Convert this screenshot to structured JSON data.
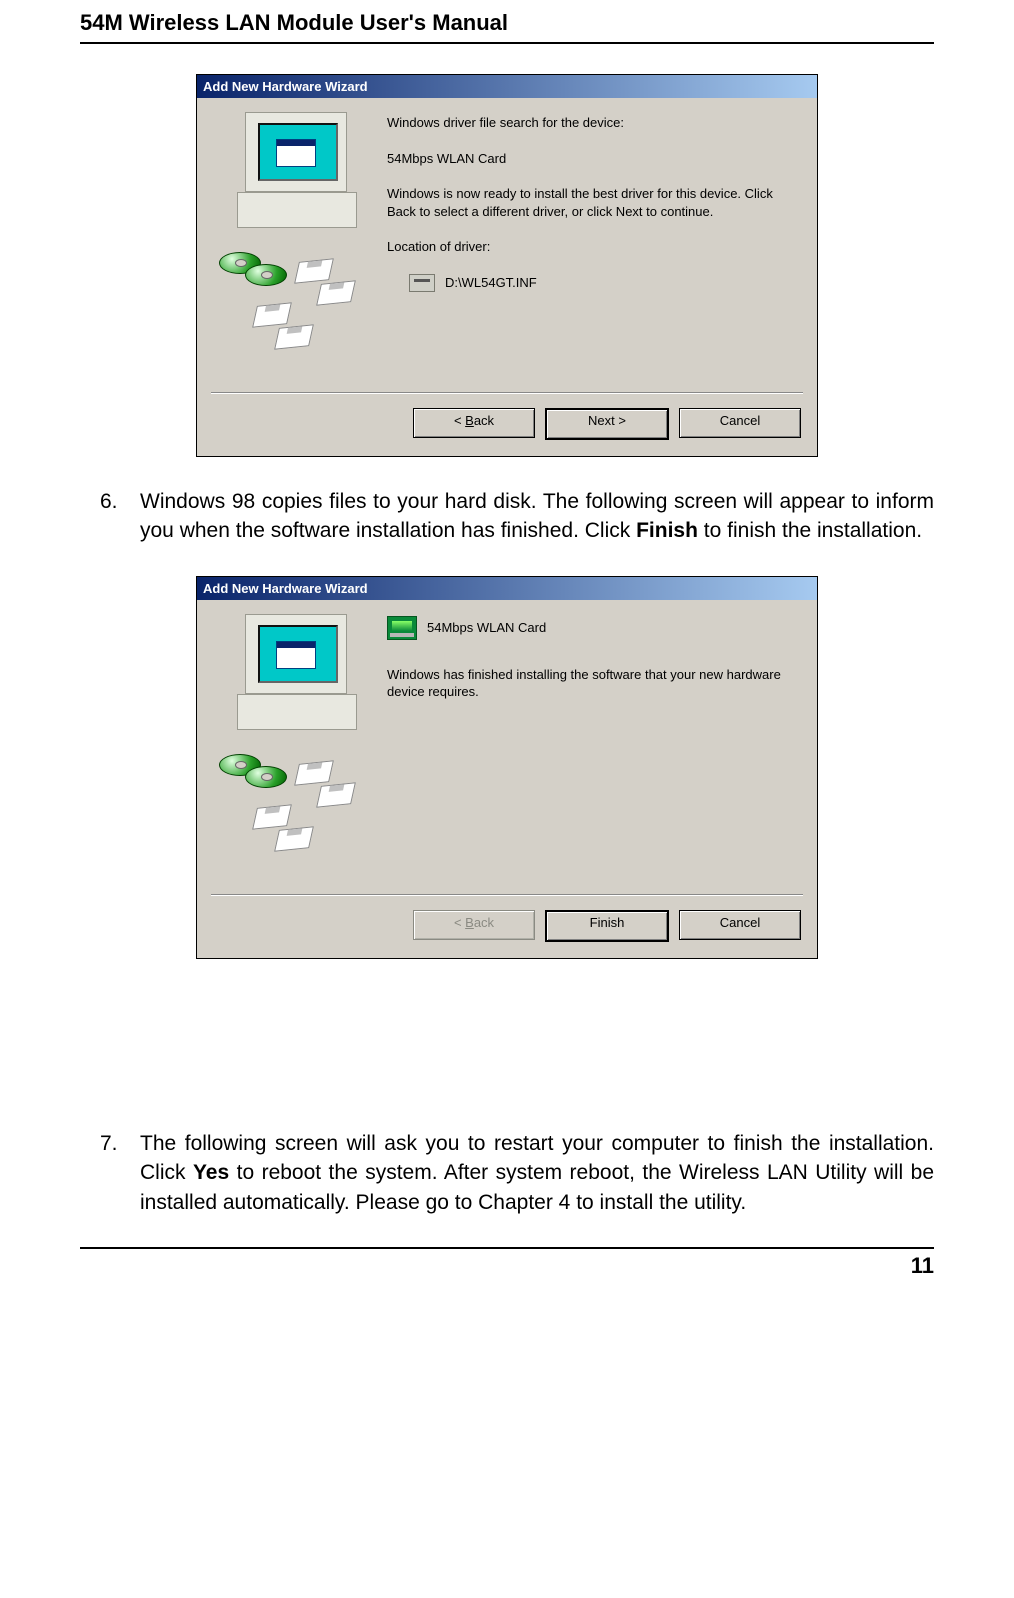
{
  "page": {
    "header": "54M Wireless LAN Module User's Manual",
    "number": "11"
  },
  "dialog1": {
    "title": "Add New Hardware Wizard",
    "search_heading": "Windows driver file search for the device:",
    "device_name": "54Mbps WLAN Card",
    "ready_text": "Windows is now ready to install the best driver for this device. Click Back to select a different driver, or click Next to continue.",
    "location_label": "Location of driver:",
    "driver_path": "D:\\WL54GT.INF",
    "btn_back_html": "< Back",
    "btn_next": "Next >",
    "btn_cancel": "Cancel"
  },
  "step6": {
    "num": "6.",
    "pre": "Windows 98 copies files to your hard disk. The following screen will appear to inform you when the software installation has finished. Click ",
    "bold": "Finish",
    "post": " to finish the installation."
  },
  "dialog2": {
    "title": "Add New Hardware Wizard",
    "device_name": "54Mbps WLAN Card",
    "finished_text": "Windows has finished installing the software that your new hardware device requires.",
    "btn_back": "< Back",
    "btn_finish": "Finish",
    "btn_cancel": "Cancel"
  },
  "step7": {
    "num": "7.",
    "pre": "The following screen will ask you to restart your computer to finish the installation. Click ",
    "bold": "Yes",
    "post": " to reboot the system. After system reboot, the Wireless LAN Utility will be installed automatically. Please go to Chapter 4 to install the utility."
  }
}
